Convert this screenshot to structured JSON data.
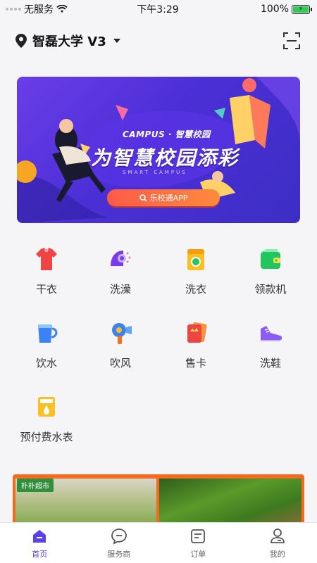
{
  "status": {
    "carrier": "无服务",
    "time": "下午3:29",
    "battery": "100%"
  },
  "header": {
    "campus": "智磊大学 V3"
  },
  "banner": {
    "campus_text": "CAMPUS · 智慧校园",
    "title": "为智慧校园添彩",
    "subtitle": "SMART CAMPUS",
    "button": "乐校通APP"
  },
  "services": [
    {
      "label": "干衣",
      "icon": "shirt-icon"
    },
    {
      "label": "洗澡",
      "icon": "shower-icon"
    },
    {
      "label": "洗衣",
      "icon": "washing-machine-icon"
    },
    {
      "label": "领款机",
      "icon": "wallet-icon"
    },
    {
      "label": "饮水",
      "icon": "cup-icon"
    },
    {
      "label": "吹风",
      "icon": "hair-dryer-icon"
    },
    {
      "label": "售卡",
      "icon": "cards-icon"
    },
    {
      "label": "洗鞋",
      "icon": "shoe-icon"
    },
    {
      "label": "预付费水表",
      "icon": "water-meter-icon"
    }
  ],
  "promo": {
    "tag": "朴朴超市"
  },
  "tabs": [
    {
      "label": "首页",
      "icon": "home-icon",
      "active": true
    },
    {
      "label": "服务商",
      "icon": "chat-icon",
      "active": false
    },
    {
      "label": "订单",
      "icon": "order-icon",
      "active": false
    },
    {
      "label": "我的",
      "icon": "profile-icon",
      "active": false
    }
  ],
  "colors": {
    "accent": "#5b3ff0",
    "banner": "#4b2fd6",
    "promo": "#f26b21"
  }
}
